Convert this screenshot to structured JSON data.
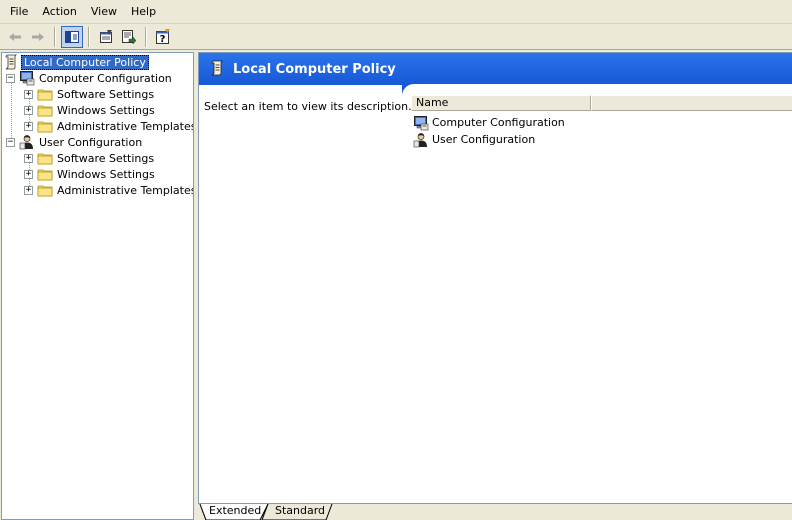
{
  "menu": [
    "File",
    "Action",
    "View",
    "Help"
  ],
  "toolbar": {
    "buttons": [
      {
        "name": "back-arrow-icon",
        "pressed": false
      },
      {
        "name": "forward-arrow-icon",
        "pressed": false
      },
      {
        "name": "show-hide-console-tree-icon",
        "pressed": true
      },
      {
        "name": "properties-icon",
        "pressed": false
      },
      {
        "name": "export-list-icon",
        "pressed": false
      },
      {
        "name": "help-icon",
        "pressed": false
      }
    ]
  },
  "tree": {
    "root": "Local Computer Policy",
    "computer_config": "Computer Configuration",
    "user_config": "User Configuration",
    "children": [
      "Software Settings",
      "Windows Settings",
      "Administrative Templates"
    ]
  },
  "banner": {
    "title": "Local Computer Policy"
  },
  "description": "Select an item to view its description.",
  "list": {
    "column_name": "Name",
    "items": [
      "Computer Configuration",
      "User Configuration"
    ]
  },
  "tabs": [
    "Extended",
    "Standard"
  ],
  "colors": {
    "banner": "#1c68e3",
    "selection": "#316ac5",
    "background": "#ece9d8"
  }
}
